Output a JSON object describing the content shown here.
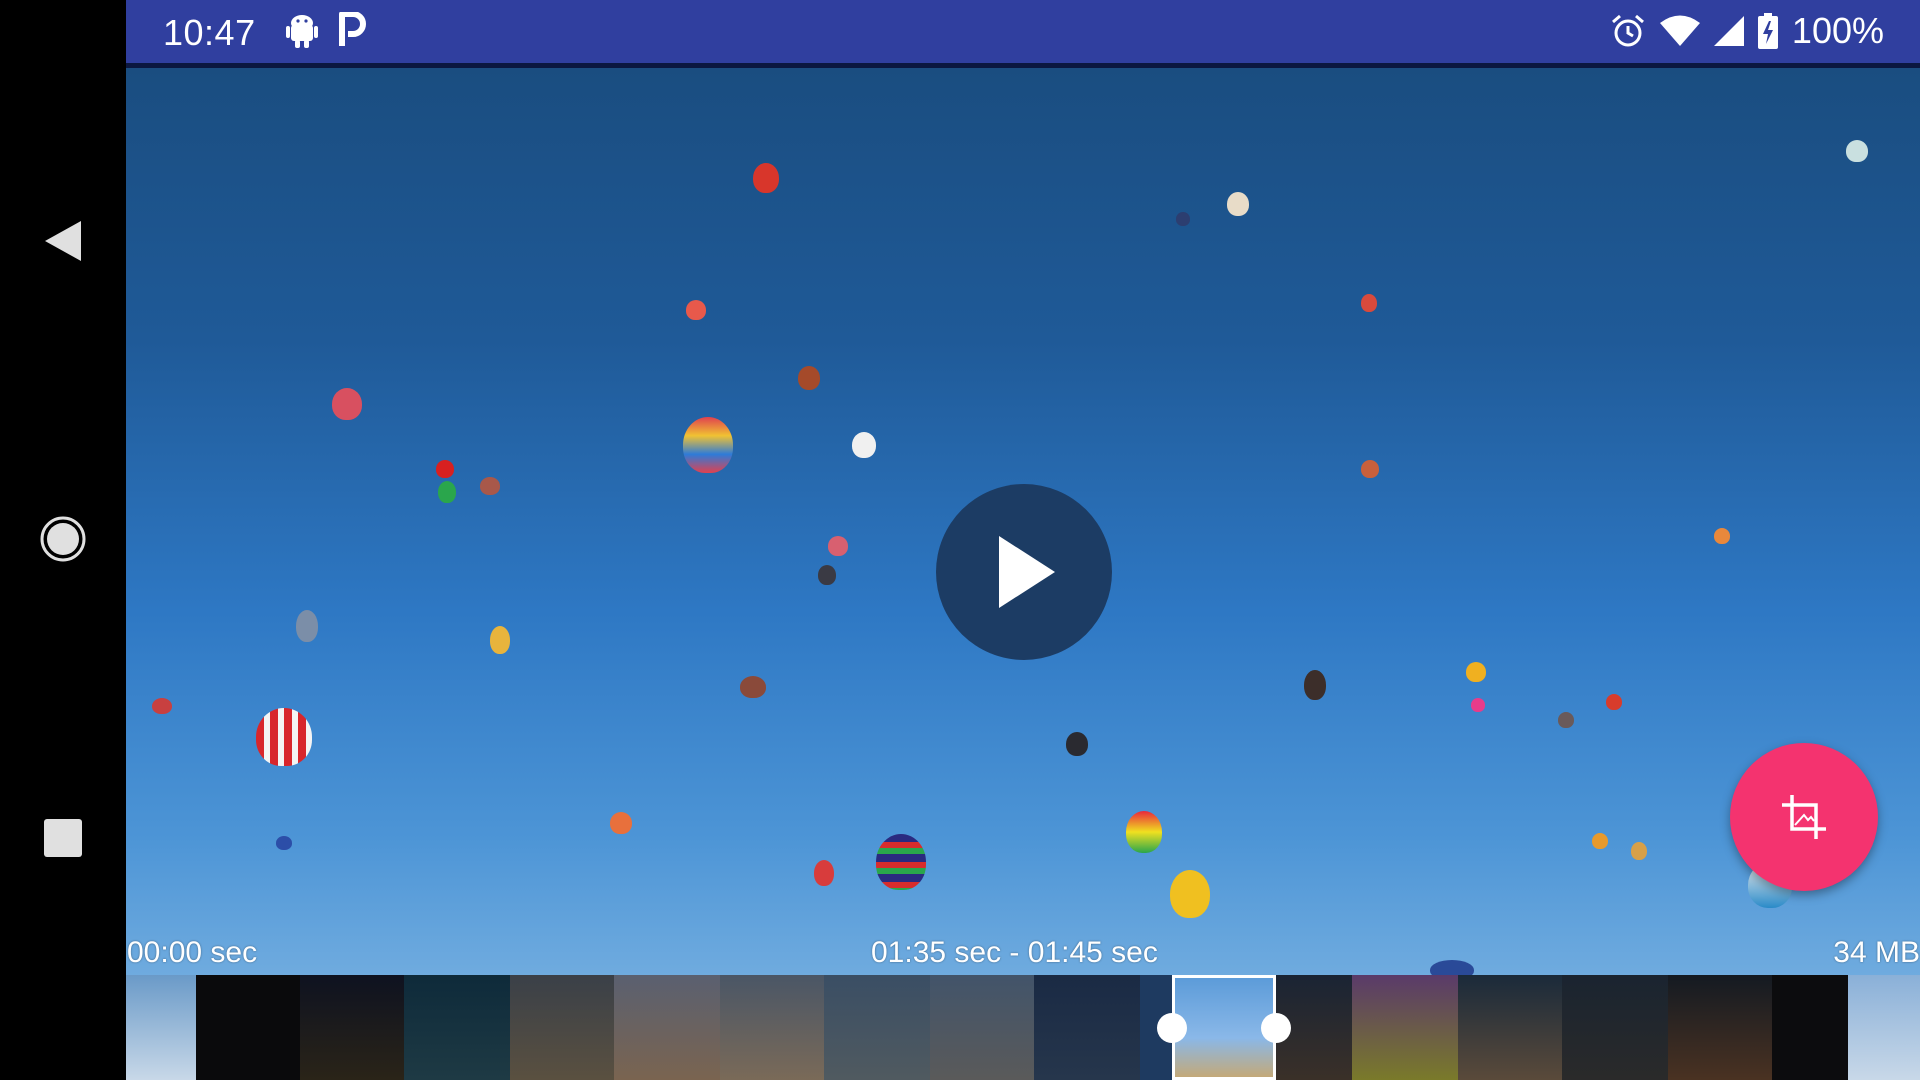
{
  "status_bar": {
    "time": "10:47",
    "battery": "100%",
    "icons": [
      "android-icon",
      "p-icon",
      "alarm-icon",
      "wifi-icon",
      "signal-icon",
      "battery-icon"
    ]
  },
  "nav": {
    "buttons": [
      "back",
      "home",
      "recents"
    ]
  },
  "video": {
    "start_label": "00:00 sec",
    "range_label": "01:35 sec - 01:45 sec",
    "size_label": "34 MB"
  },
  "colors": {
    "status_bar": "#303f9f",
    "fab": "#f4336f",
    "play_bg": "#1c3c64"
  }
}
